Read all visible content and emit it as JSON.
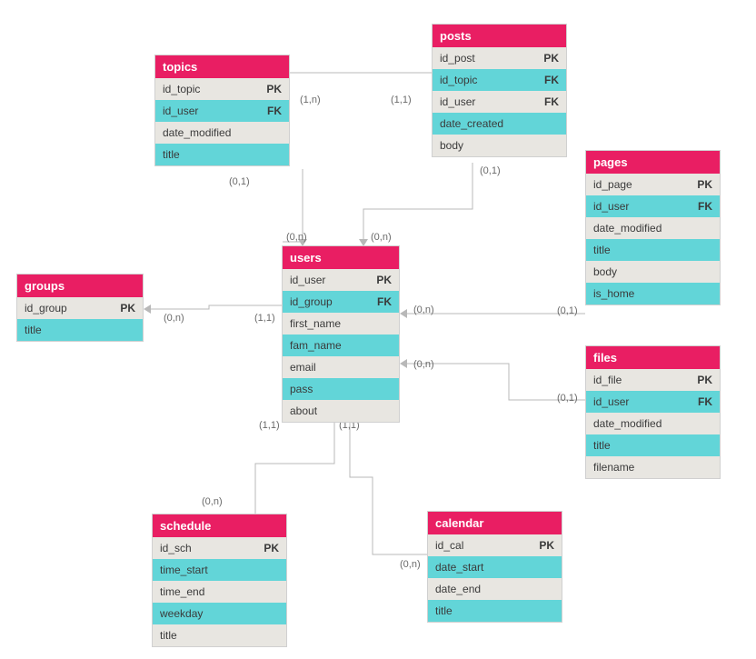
{
  "diagram": {
    "type": "entity-relationship",
    "entities": {
      "topics": {
        "title": "topics",
        "rows": [
          [
            "id_topic",
            "PK"
          ],
          [
            "id_user",
            "FK"
          ],
          [
            "date_modified",
            ""
          ],
          [
            "title",
            ""
          ]
        ]
      },
      "posts": {
        "title": "posts",
        "rows": [
          [
            "id_post",
            "PK"
          ],
          [
            "id_topic",
            "FK"
          ],
          [
            "id_user",
            "FK"
          ],
          [
            "date_created",
            ""
          ],
          [
            "body",
            ""
          ]
        ]
      },
      "pages": {
        "title": "pages",
        "rows": [
          [
            "id_page",
            "PK"
          ],
          [
            "id_user",
            "FK"
          ],
          [
            "date_modified",
            ""
          ],
          [
            "title",
            ""
          ],
          [
            "body",
            ""
          ],
          [
            "is_home",
            ""
          ]
        ]
      },
      "users": {
        "title": "users",
        "rows": [
          [
            "id_user",
            "PK"
          ],
          [
            "id_group",
            "FK"
          ],
          [
            "first_name",
            ""
          ],
          [
            "fam_name",
            ""
          ],
          [
            "email",
            ""
          ],
          [
            "pass",
            ""
          ],
          [
            "about",
            ""
          ]
        ]
      },
      "groups": {
        "title": "groups",
        "rows": [
          [
            "id_group",
            "PK"
          ],
          [
            "title",
            ""
          ]
        ]
      },
      "files": {
        "title": "files",
        "rows": [
          [
            "id_file",
            "PK"
          ],
          [
            "id_user",
            "FK"
          ],
          [
            "date_modified",
            ""
          ],
          [
            "title",
            ""
          ],
          [
            "filename",
            ""
          ]
        ]
      },
      "schedule": {
        "title": "schedule",
        "rows": [
          [
            "id_sch",
            "PK"
          ],
          [
            "time_start",
            ""
          ],
          [
            "time_end",
            ""
          ],
          [
            "weekday",
            ""
          ],
          [
            "title",
            ""
          ]
        ]
      },
      "calendar": {
        "title": "calendar",
        "rows": [
          [
            "id_cal",
            "PK"
          ],
          [
            "date_start",
            ""
          ],
          [
            "date_end",
            ""
          ],
          [
            "title",
            ""
          ]
        ]
      }
    },
    "cardinalities": {
      "topics_posts_left": "(1,n)",
      "topics_posts_right": "(1,1)",
      "topics_users_top": "(0,1)",
      "topics_users_bot": "(0,n)",
      "posts_users_top": "(0,1)",
      "posts_users_bot": "(0,n)",
      "users_groups_left": "(1,1)",
      "users_groups_right": "(0,n)",
      "pages_users_left": "(0,1)",
      "users_pages_right": "(0,n)",
      "files_users_left": "(0,1)",
      "users_files_right": "(0,n)",
      "schedule_users_top": "(1,1)",
      "schedule_users_bot": "(0,n)",
      "calendar_users_top": "(1,1)",
      "calendar_users_bot": "(0,n)"
    }
  }
}
